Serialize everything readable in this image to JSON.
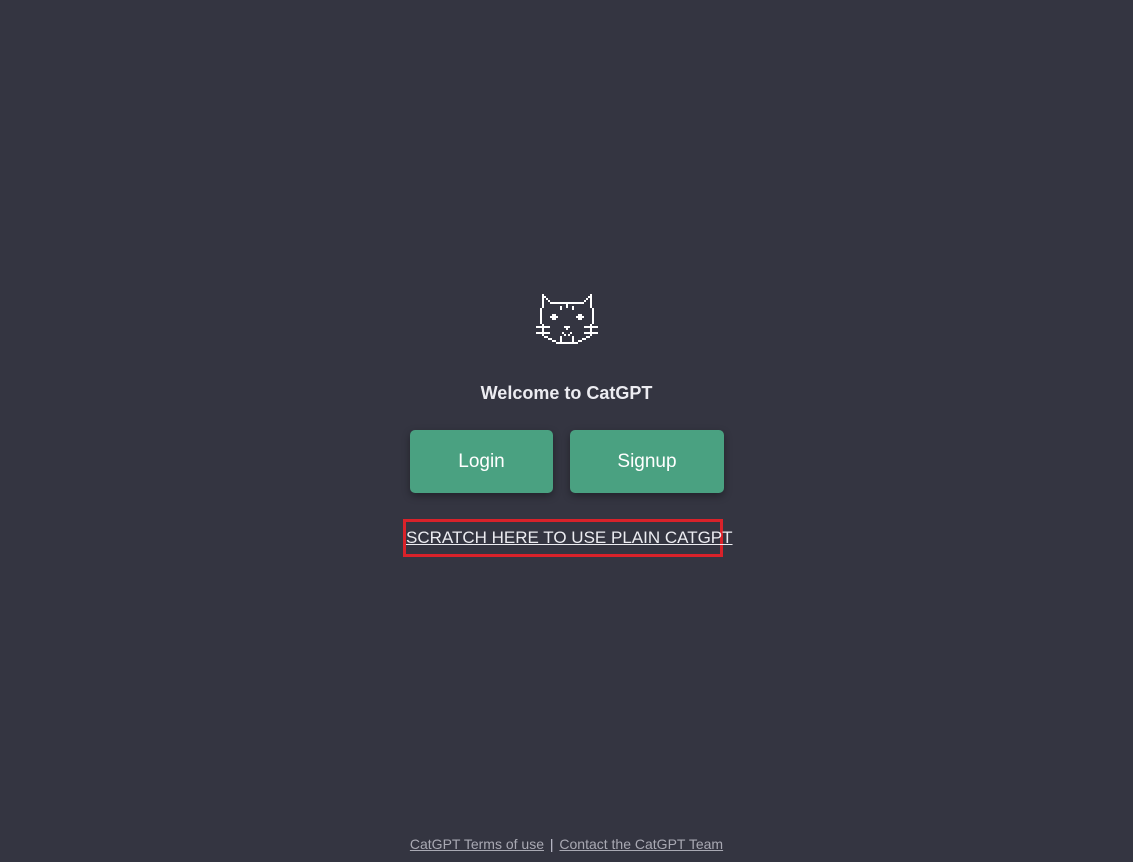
{
  "brand": {
    "logo_icon": "pixel-cat-icon",
    "welcome_text": "Welcome to CatGPT"
  },
  "auth": {
    "login_label": "Login",
    "signup_label": "Signup"
  },
  "scratch_link": {
    "label": "SCRATCH HERE TO USE PLAIN CATGPT"
  },
  "footer": {
    "terms_label": "CatGPT Terms of use",
    "separator": "|",
    "contact_label": "Contact the CatGPT Team"
  },
  "colors": {
    "background": "#343541",
    "button": "#4aa181",
    "highlight_border": "#d9222a",
    "text": "#ececf1",
    "footer_text": "#a9a9b3"
  }
}
